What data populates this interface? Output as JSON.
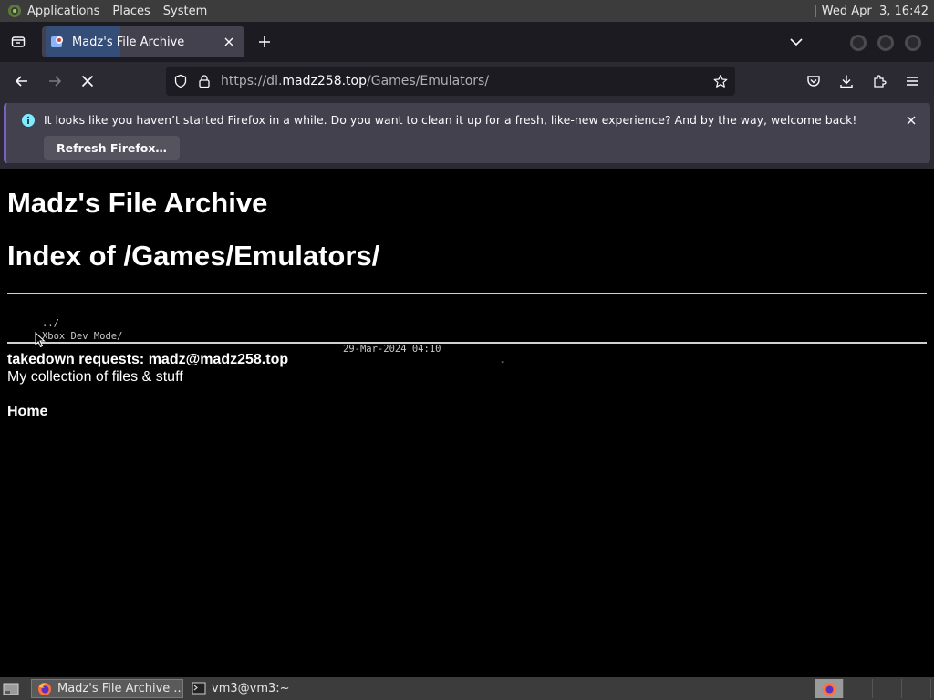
{
  "desktop_panel": {
    "menus": [
      "Applications",
      "Places",
      "System"
    ],
    "clock": "Wed Apr  3, 16:42"
  },
  "browser": {
    "tab": {
      "title": "Madz's File Archive"
    },
    "url": {
      "prefix": "https://dl.",
      "domain": "madz258.top",
      "path": "/Games/Emulators/"
    },
    "notification": {
      "message": "It looks like you haven’t started Firefox in a while. Do you want to clean it up for a fresh, like-new experience? And by the way, welcome back!",
      "button_label": "Refresh Firefox…"
    }
  },
  "page": {
    "site_title": "Madz's File Archive",
    "index_title": "Index of /Games/Emulators/",
    "listing": [
      {
        "name": "../",
        "date": "",
        "size": ""
      },
      {
        "name": "Xbox Dev Mode/",
        "date": "29-Mar-2024 04:10",
        "size": "-"
      }
    ],
    "takedown": "takedown requests: madz@madz258.top",
    "tagline": "My collection of files & stuff",
    "home_link": "Home"
  },
  "taskbar": {
    "tasks": [
      "Madz's File Archive ...",
      "vm3@vm3:~"
    ]
  },
  "colors": {
    "panel": "#3c3c3c",
    "tabbar": "#1c1b22",
    "toolbar": "#2b2a33",
    "notification": "#42414d",
    "accent": "#7b5fc7"
  }
}
